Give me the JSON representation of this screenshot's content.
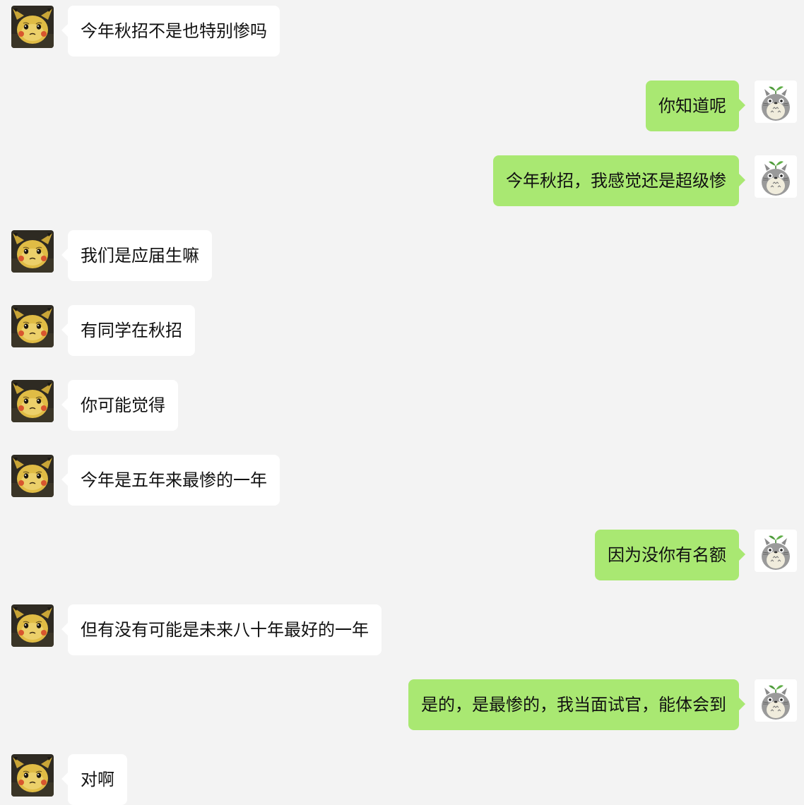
{
  "messages": [
    {
      "side": "left",
      "avatar": "pikachu-avatar",
      "text": "今年秋招不是也特别惨吗"
    },
    {
      "side": "right",
      "avatar": "totoro-avatar",
      "text": "你知道呢"
    },
    {
      "side": "right",
      "avatar": "totoro-avatar",
      "text": "今年秋招，我感觉还是超级惨"
    },
    {
      "side": "left",
      "avatar": "pikachu-avatar",
      "text": "我们是应届生嘛"
    },
    {
      "side": "left",
      "avatar": "pikachu-avatar",
      "text": "有同学在秋招"
    },
    {
      "side": "left",
      "avatar": "pikachu-avatar",
      "text": "你可能觉得"
    },
    {
      "side": "left",
      "avatar": "pikachu-avatar",
      "text": "今年是五年来最惨的一年"
    },
    {
      "side": "right",
      "avatar": "totoro-avatar",
      "text": "因为没你有名额"
    },
    {
      "side": "left",
      "avatar": "pikachu-avatar",
      "text": "但有没有可能是未来八十年最好的一年"
    },
    {
      "side": "right",
      "avatar": "totoro-avatar",
      "text": "是的，是最惨的，我当面试官，能体会到"
    },
    {
      "side": "left",
      "avatar": "pikachu-avatar",
      "text": "对啊"
    }
  ],
  "colors": {
    "background": "#f3f3f3",
    "incoming_bubble": "#ffffff",
    "outgoing_bubble": "#a9e872"
  }
}
